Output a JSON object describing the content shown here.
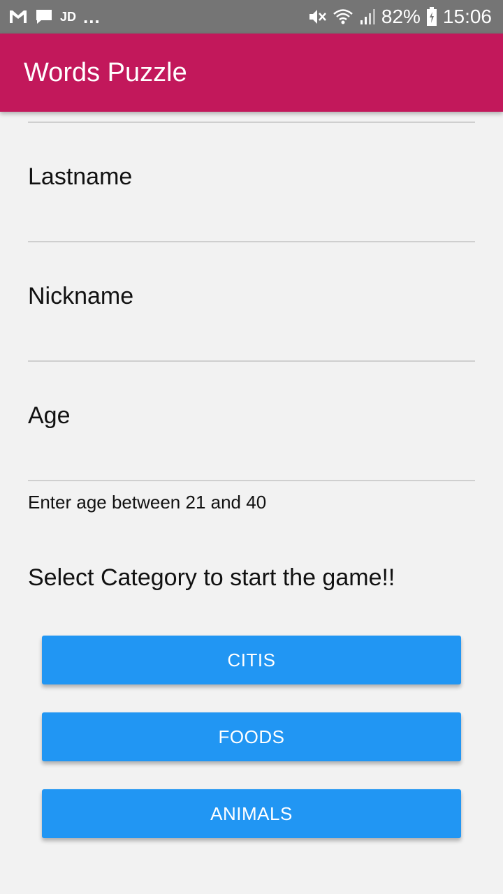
{
  "status_bar": {
    "carrier_icon": "gmail-icon",
    "message_icon": "message-icon",
    "jd_label": "JD",
    "overflow": "...",
    "mute_icon": "mute-icon",
    "wifi_icon": "wifi-icon",
    "signal_icon": "signal-icon",
    "battery_percent": "82%",
    "battery_icon": "battery-charging-icon",
    "time": "15:06"
  },
  "app_bar": {
    "title": "Words Puzzle",
    "color": "#c2185b"
  },
  "form": {
    "fields": [
      {
        "label": "Lastname"
      },
      {
        "label": "Nickname"
      },
      {
        "label": "Age"
      }
    ],
    "age_helper": "Enter age between 21 and 40"
  },
  "category": {
    "prompt": "Select Category to start the game!!",
    "buttons": [
      {
        "label": "CITIS"
      },
      {
        "label": "FOODS"
      },
      {
        "label": "ANIMALS"
      }
    ],
    "button_color": "#2196f3"
  }
}
